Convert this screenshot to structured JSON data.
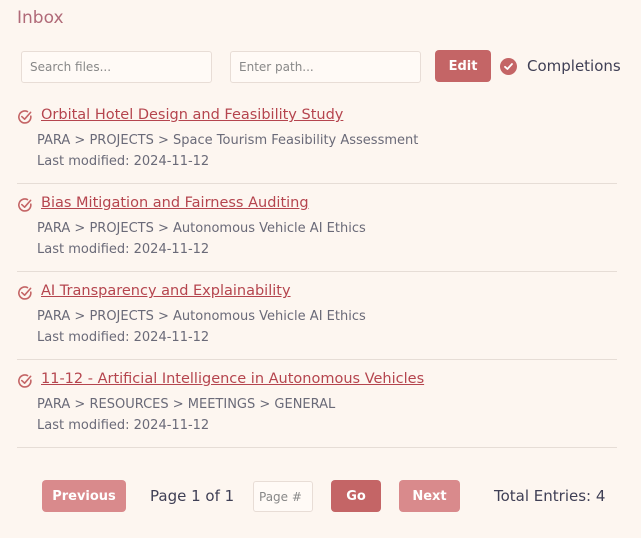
{
  "header": {
    "title": "Inbox"
  },
  "toolbar": {
    "search_placeholder": "Search files...",
    "path_placeholder": "Enter path...",
    "edit_label": "Edit",
    "completions_label": "Completions"
  },
  "items": [
    {
      "title": "Orbital Hotel Design and Feasibility Study",
      "path": "PARA > PROJECTS > Space Tourism Feasibility Assessment",
      "modified": "Last modified: 2024-11-12"
    },
    {
      "title": "Bias Mitigation and Fairness Auditing",
      "path": "PARA > PROJECTS > Autonomous Vehicle AI Ethics",
      "modified": "Last modified: 2024-11-12"
    },
    {
      "title": "AI Transparency and Explainability",
      "path": "PARA > PROJECTS > Autonomous Vehicle AI Ethics",
      "modified": "Last modified: 2024-11-12"
    },
    {
      "title": "11-12 - Artificial Intelligence in Autonomous Vehicles",
      "path": "PARA > RESOURCES > MEETINGS > GENERAL",
      "modified": "Last modified: 2024-11-12"
    }
  ],
  "pagination": {
    "previous_label": "Previous",
    "page_info": "Page 1 of 1",
    "page_placeholder": "Page #",
    "go_label": "Go",
    "next_label": "Next",
    "total_entries": "Total Entries: 4"
  },
  "colors": {
    "accent": "#c46566",
    "accent_light": "#d98a8c",
    "link": "#b5454e",
    "background": "#fdf6f0"
  },
  "icons": {
    "item": "check-circle-outline-icon",
    "completions": "check-circle-filled-icon"
  }
}
